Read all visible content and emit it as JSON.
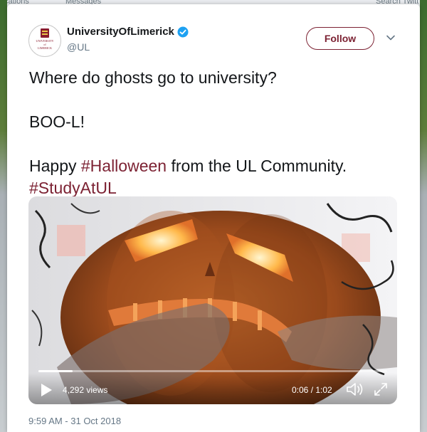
{
  "background": {
    "left_text": "cations",
    "messages_label": "Messages",
    "search_text": "Search Twitt"
  },
  "tweet": {
    "display_name": "UniversityOfLimerick",
    "handle": "@UL",
    "verified": true,
    "follow_label": "Follow",
    "avatar_text_line1": "UNIVERSITY",
    "avatar_text_line2": "of",
    "avatar_text_line3": "LIMERICK",
    "lines": {
      "line1": "Where do ghosts go to university?",
      "line2": "BOO-L!",
      "line3_prefix": "Happy ",
      "line3_hashtag": "#Halloween",
      "line3_suffix": " from the UL Community.",
      "line4_hashtag": "#StudyAtUL"
    },
    "timestamp": "9:59 AM - 31 Oct 2018"
  },
  "video": {
    "views": "4,292 views",
    "time": "0:06 / 1:02",
    "progress_fraction": 0.097
  },
  "colors": {
    "accent": "#7c2233",
    "verified": "#1da1f2",
    "text": "#14171a",
    "muted": "#657786"
  },
  "icons": {
    "play": "play-icon",
    "volume": "volume-icon",
    "fullscreen": "fullscreen-icon",
    "chevron": "chevron-down-icon",
    "verified": "verified-badge-icon"
  }
}
